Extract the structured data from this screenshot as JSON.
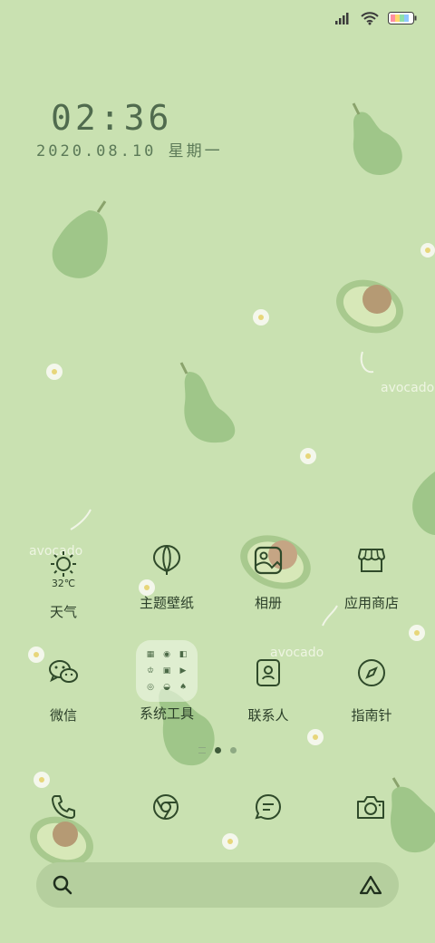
{
  "status_bar": {
    "icons": [
      "signal-icon",
      "wifi-icon",
      "battery-icon"
    ]
  },
  "lockclock": {
    "time": "02:36",
    "date": "2020.08.10 星期一"
  },
  "wallpaper": {
    "words": [
      "avocado",
      "avocado",
      "avocado"
    ]
  },
  "weather": {
    "temp": "32℃",
    "label": "天气"
  },
  "apps_row1": [
    {
      "label": "主题壁纸",
      "icon": "balloon-icon"
    },
    {
      "label": "相册",
      "icon": "gallery-icon"
    },
    {
      "label": "应用商店",
      "icon": "store-icon"
    }
  ],
  "apps_row2": [
    {
      "label": "微信",
      "icon": "wechat-icon"
    },
    {
      "label": "系统工具",
      "icon": "folder-icon"
    },
    {
      "label": "联系人",
      "icon": "contacts-icon"
    },
    {
      "label": "指南针",
      "icon": "compass-icon"
    }
  ],
  "dock": [
    {
      "icon": "phone-icon"
    },
    {
      "icon": "browser-icon"
    },
    {
      "icon": "messages-icon"
    },
    {
      "icon": "camera-icon"
    }
  ],
  "colors": {
    "background": "#c9e1b1",
    "icon_stroke": "#2f4a2a",
    "searchbar": "#b5cf9e"
  }
}
